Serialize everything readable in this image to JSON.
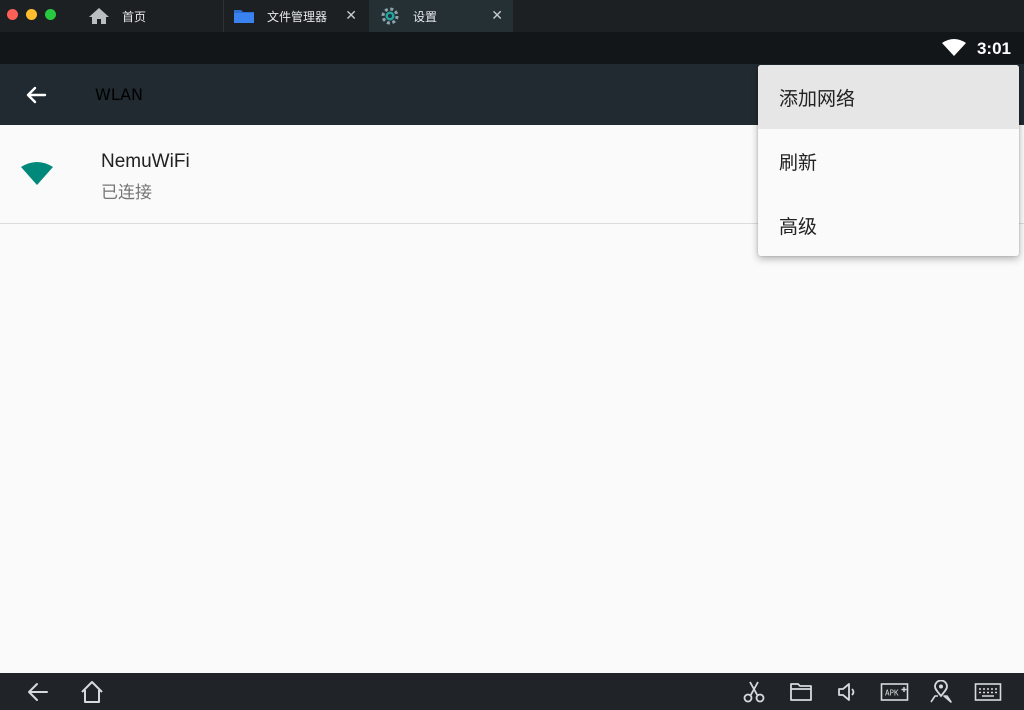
{
  "window": {
    "tabs": [
      {
        "label": "首页",
        "icon": "home-icon"
      },
      {
        "label": "文件管理器",
        "icon": "folder-icon"
      },
      {
        "label": "设置",
        "icon": "settings-gear-icon"
      }
    ],
    "traffic_colors": [
      "#fe5f57",
      "#febc2e",
      "#28c840"
    ]
  },
  "statusbar": {
    "time": "3:01",
    "wifi_icon": "wifi-icon"
  },
  "appbar": {
    "title": "WLAN",
    "back_icon": "back-arrow-icon"
  },
  "networks": [
    {
      "name": "NemuWiFi",
      "status": "已连接",
      "signal_color": "#00897b"
    }
  ],
  "menu": {
    "items": [
      "添加网络",
      "刷新",
      "高级"
    ],
    "active_index": 0
  },
  "bottom_nav": {
    "left": [
      "back-icon",
      "home-icon"
    ],
    "right": [
      "scissors-icon",
      "folder-icon",
      "volume-icon",
      "apk-install-icon",
      "location-icon",
      "keyboard-icon"
    ]
  }
}
